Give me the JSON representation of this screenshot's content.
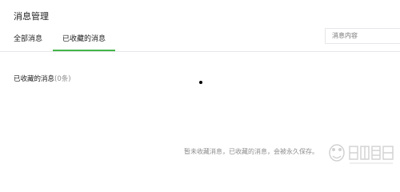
{
  "header": {
    "title": "消息管理"
  },
  "tabs": [
    {
      "label": "全部消息",
      "active": false
    },
    {
      "label": "已收藏的消息",
      "active": true
    }
  ],
  "search": {
    "placeholder": "消息内容"
  },
  "section": {
    "title": "已收藏的消息",
    "count": "(0条)"
  },
  "empty_state": {
    "message": "暂未收藏消息，已收藏的消息，会被永久保存。"
  },
  "colors": {
    "accent": "#44b549",
    "divider": "#e7e7eb",
    "muted_text": "#8d8d8d"
  },
  "icons": {
    "watermark": "baidu-jingyan-watermark"
  }
}
